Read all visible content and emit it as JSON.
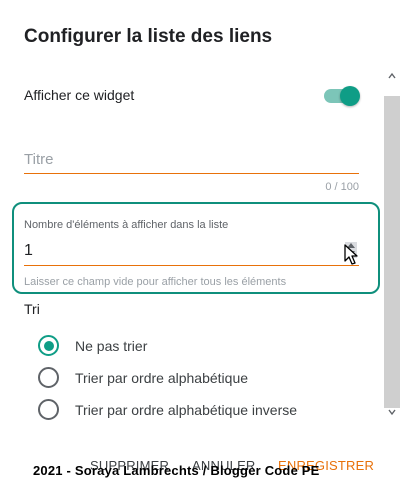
{
  "dialog": {
    "title": "Configurer la liste des liens",
    "show_widget_label": "Afficher ce widget",
    "show_widget_on": true,
    "title_field": {
      "placeholder": "Titre",
      "value": "",
      "counter": "0 / 100"
    },
    "items_field": {
      "label": "Nombre d'éléments à afficher dans la liste",
      "value": "1",
      "hint": "Laisser ce champ vide pour afficher tous les éléments"
    },
    "sort": {
      "label": "Tri",
      "options": [
        {
          "label": "Ne pas trier",
          "checked": true
        },
        {
          "label": "Trier par ordre alphabétique",
          "checked": false
        },
        {
          "label": "Trier par ordre alphabétique inverse",
          "checked": false
        }
      ]
    },
    "actions": {
      "delete_label": "SUPPRIMER",
      "cancel_label": "ANNULER",
      "save_label": "ENREGISTRER"
    }
  },
  "watermark": "2021 - Soraya Lambrechts / Blogger Code PE",
  "colors": {
    "accent": "#0f9d86",
    "highlight_border": "#0f8f7c",
    "underline": "#e8710a",
    "save": "#e8710a"
  }
}
